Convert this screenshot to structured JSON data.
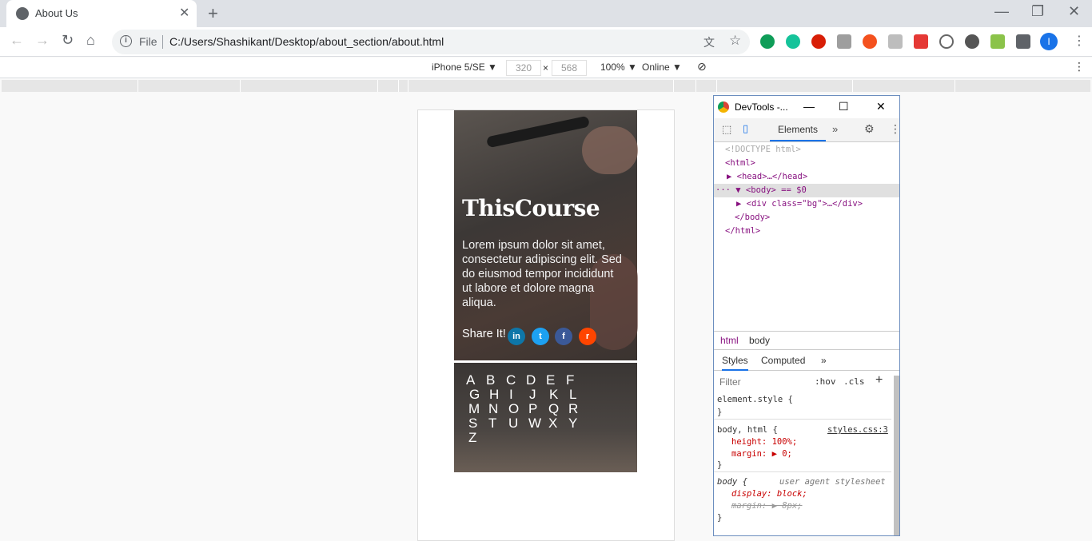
{
  "browser": {
    "tab_title": "About Us",
    "close_tab": "✕",
    "new_tab": "+",
    "window_controls": [
      "—",
      "❐",
      "✕"
    ],
    "omnibox": {
      "file_label": "File",
      "url": "C:/Users/Shashikant/Desktop/about_section/about.html"
    },
    "profile_initial": "I",
    "extensions_menu": "⋮"
  },
  "device_toolbar": {
    "device": "iPhone 5/SE ▼",
    "width": "320",
    "times": "×",
    "height": "568",
    "zoom": "100% ▼",
    "network": "Online ▼",
    "rotate": "⃠",
    "more": "⋮"
  },
  "page": {
    "brand": "ThisCourse",
    "body": "Lorem ipsum dolor sit amet, consectetur adipiscing elit. Sed do eiusmod tempor incididunt ut labore et dolore magna aliqua.",
    "share_label": "Share It!",
    "social": [
      {
        "name": "linkedin",
        "glyph": "in",
        "color": "#0e76a8"
      },
      {
        "name": "twitter",
        "glyph": "t",
        "color": "#1da1f2"
      },
      {
        "name": "facebook",
        "glyph": "f",
        "color": "#3b5998"
      },
      {
        "name": "reddit",
        "glyph": "r",
        "color": "#ff4500"
      }
    ],
    "alphabet_rows": [
      [
        "A",
        "B",
        "C",
        "D",
        "E",
        "F"
      ],
      [
        "G",
        "H",
        "I",
        "J",
        "K",
        "L"
      ],
      [
        "M",
        "N",
        "O",
        "P",
        "Q",
        "R"
      ],
      [
        "S",
        "T",
        "U",
        "W",
        "X",
        "Y"
      ],
      [
        "Z"
      ]
    ]
  },
  "devtools": {
    "title": "DevTools -...",
    "win_buttons": [
      "—",
      "☐",
      "✕"
    ],
    "tabs": {
      "elements": "Elements",
      "more": "»"
    },
    "dom_lines": [
      {
        "text": "<!DOCTYPE html>",
        "cls": "cm"
      },
      {
        "text": "<html>",
        "cls": "tg"
      },
      {
        "text": "▶ <head>…</head>",
        "cls": "tg"
      },
      {
        "text": "··· ▼ <body> == $0",
        "cls": "tg"
      },
      {
        "text": "▶ <div class=\"bg\">…</div>",
        "cls": "tg"
      },
      {
        "text": "</body>",
        "cls": "tg"
      },
      {
        "text": "</html>",
        "cls": "tg"
      }
    ],
    "breadcrumbs": [
      "html",
      "body"
    ],
    "styles_tabs": [
      "Styles",
      "Computed",
      "»"
    ],
    "filter": {
      "placeholder": "Filter",
      "hov": ":hov",
      "cls": ".cls",
      "add": "+"
    },
    "rules": [
      {
        "text": "element.style {"
      },
      {
        "text": "}"
      },
      {
        "text": "body, html {",
        "src": "styles.css:3"
      },
      {
        "text": "height: 100%;",
        "prop": true
      },
      {
        "text": "margin: ▶ 0;",
        "prop": true
      },
      {
        "text": "}"
      },
      {
        "text": "body {",
        "src": "user agent stylesheet"
      },
      {
        "text": "display: block;",
        "prop": true
      },
      {
        "text": "margin: ▶ 8px;",
        "prop": true,
        "strike": true
      },
      {
        "text": "}"
      }
    ]
  }
}
